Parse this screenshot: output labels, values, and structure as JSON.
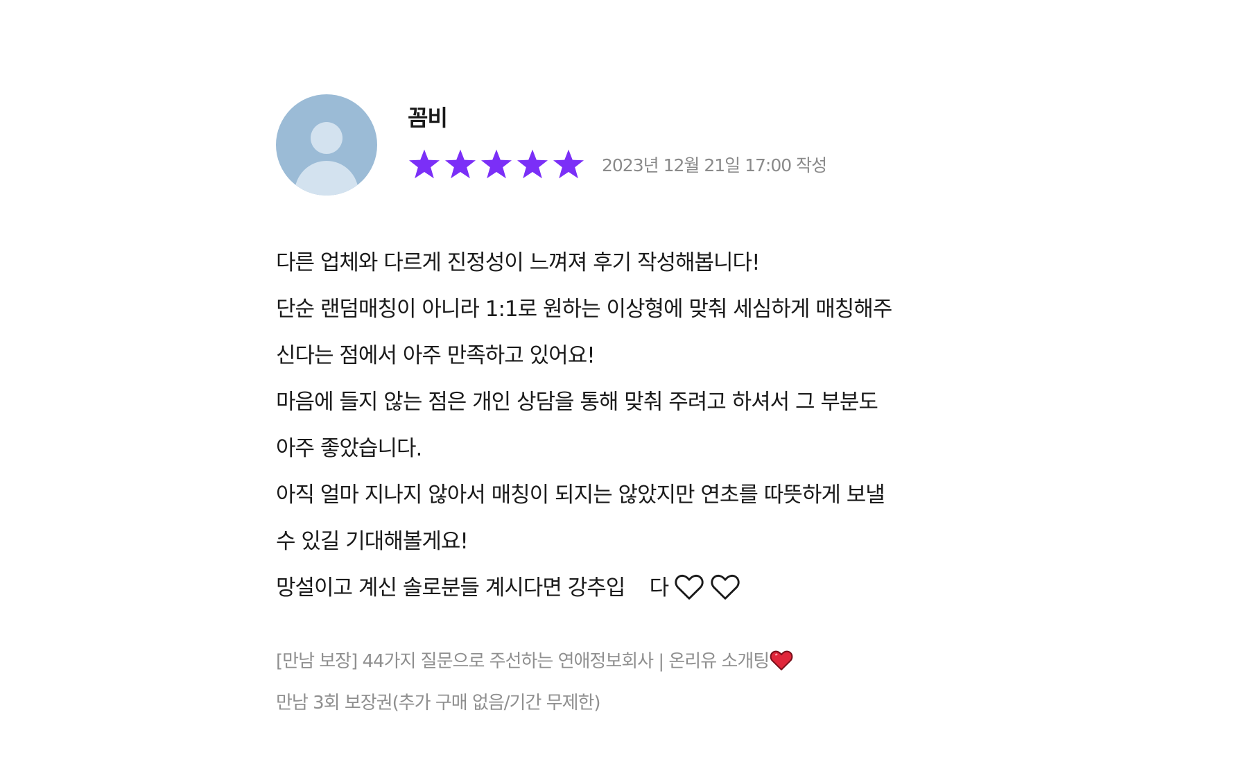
{
  "review": {
    "author": "꼼비",
    "rating": 5,
    "rating_max": 5,
    "star_color": "#7b2ff7",
    "date": "2023년 12월 21일 17:00 작성",
    "body_lines": [
      "다른 업체와 다르게 진정성이 느껴져 후기 작성해봅니다!",
      "단순 랜덤매칭이 아니라 1:1로 원하는 이상형에 맞춰 세심하게 매칭해주",
      "신다는 점에서 아주 만족하고 있어요!",
      "마음에 들지 않는 점은 개인 상담을 통해 맞춰 주려고 하셔서 그 부분도",
      "아주 좋았습니다.",
      "아직 얼마 지나지 않아서 매칭이 되지는 않았지만 연초를 따뜻하게 보낼",
      "수 있길 기대해볼게요!",
      "망설이고 계신 솔로분들 계시다면 강추입    다"
    ],
    "body_icons": [
      "white-heart-icon",
      "white-heart-icon"
    ],
    "product": {
      "title": "[만남 보장] 44가지 질문으로 주선하는 연애정보회사 | 온리유 소개팅",
      "title_icon": "red-heart-icon",
      "option": "만남 3회 보장권(추가 구매 없음/기간 무제한)"
    }
  }
}
